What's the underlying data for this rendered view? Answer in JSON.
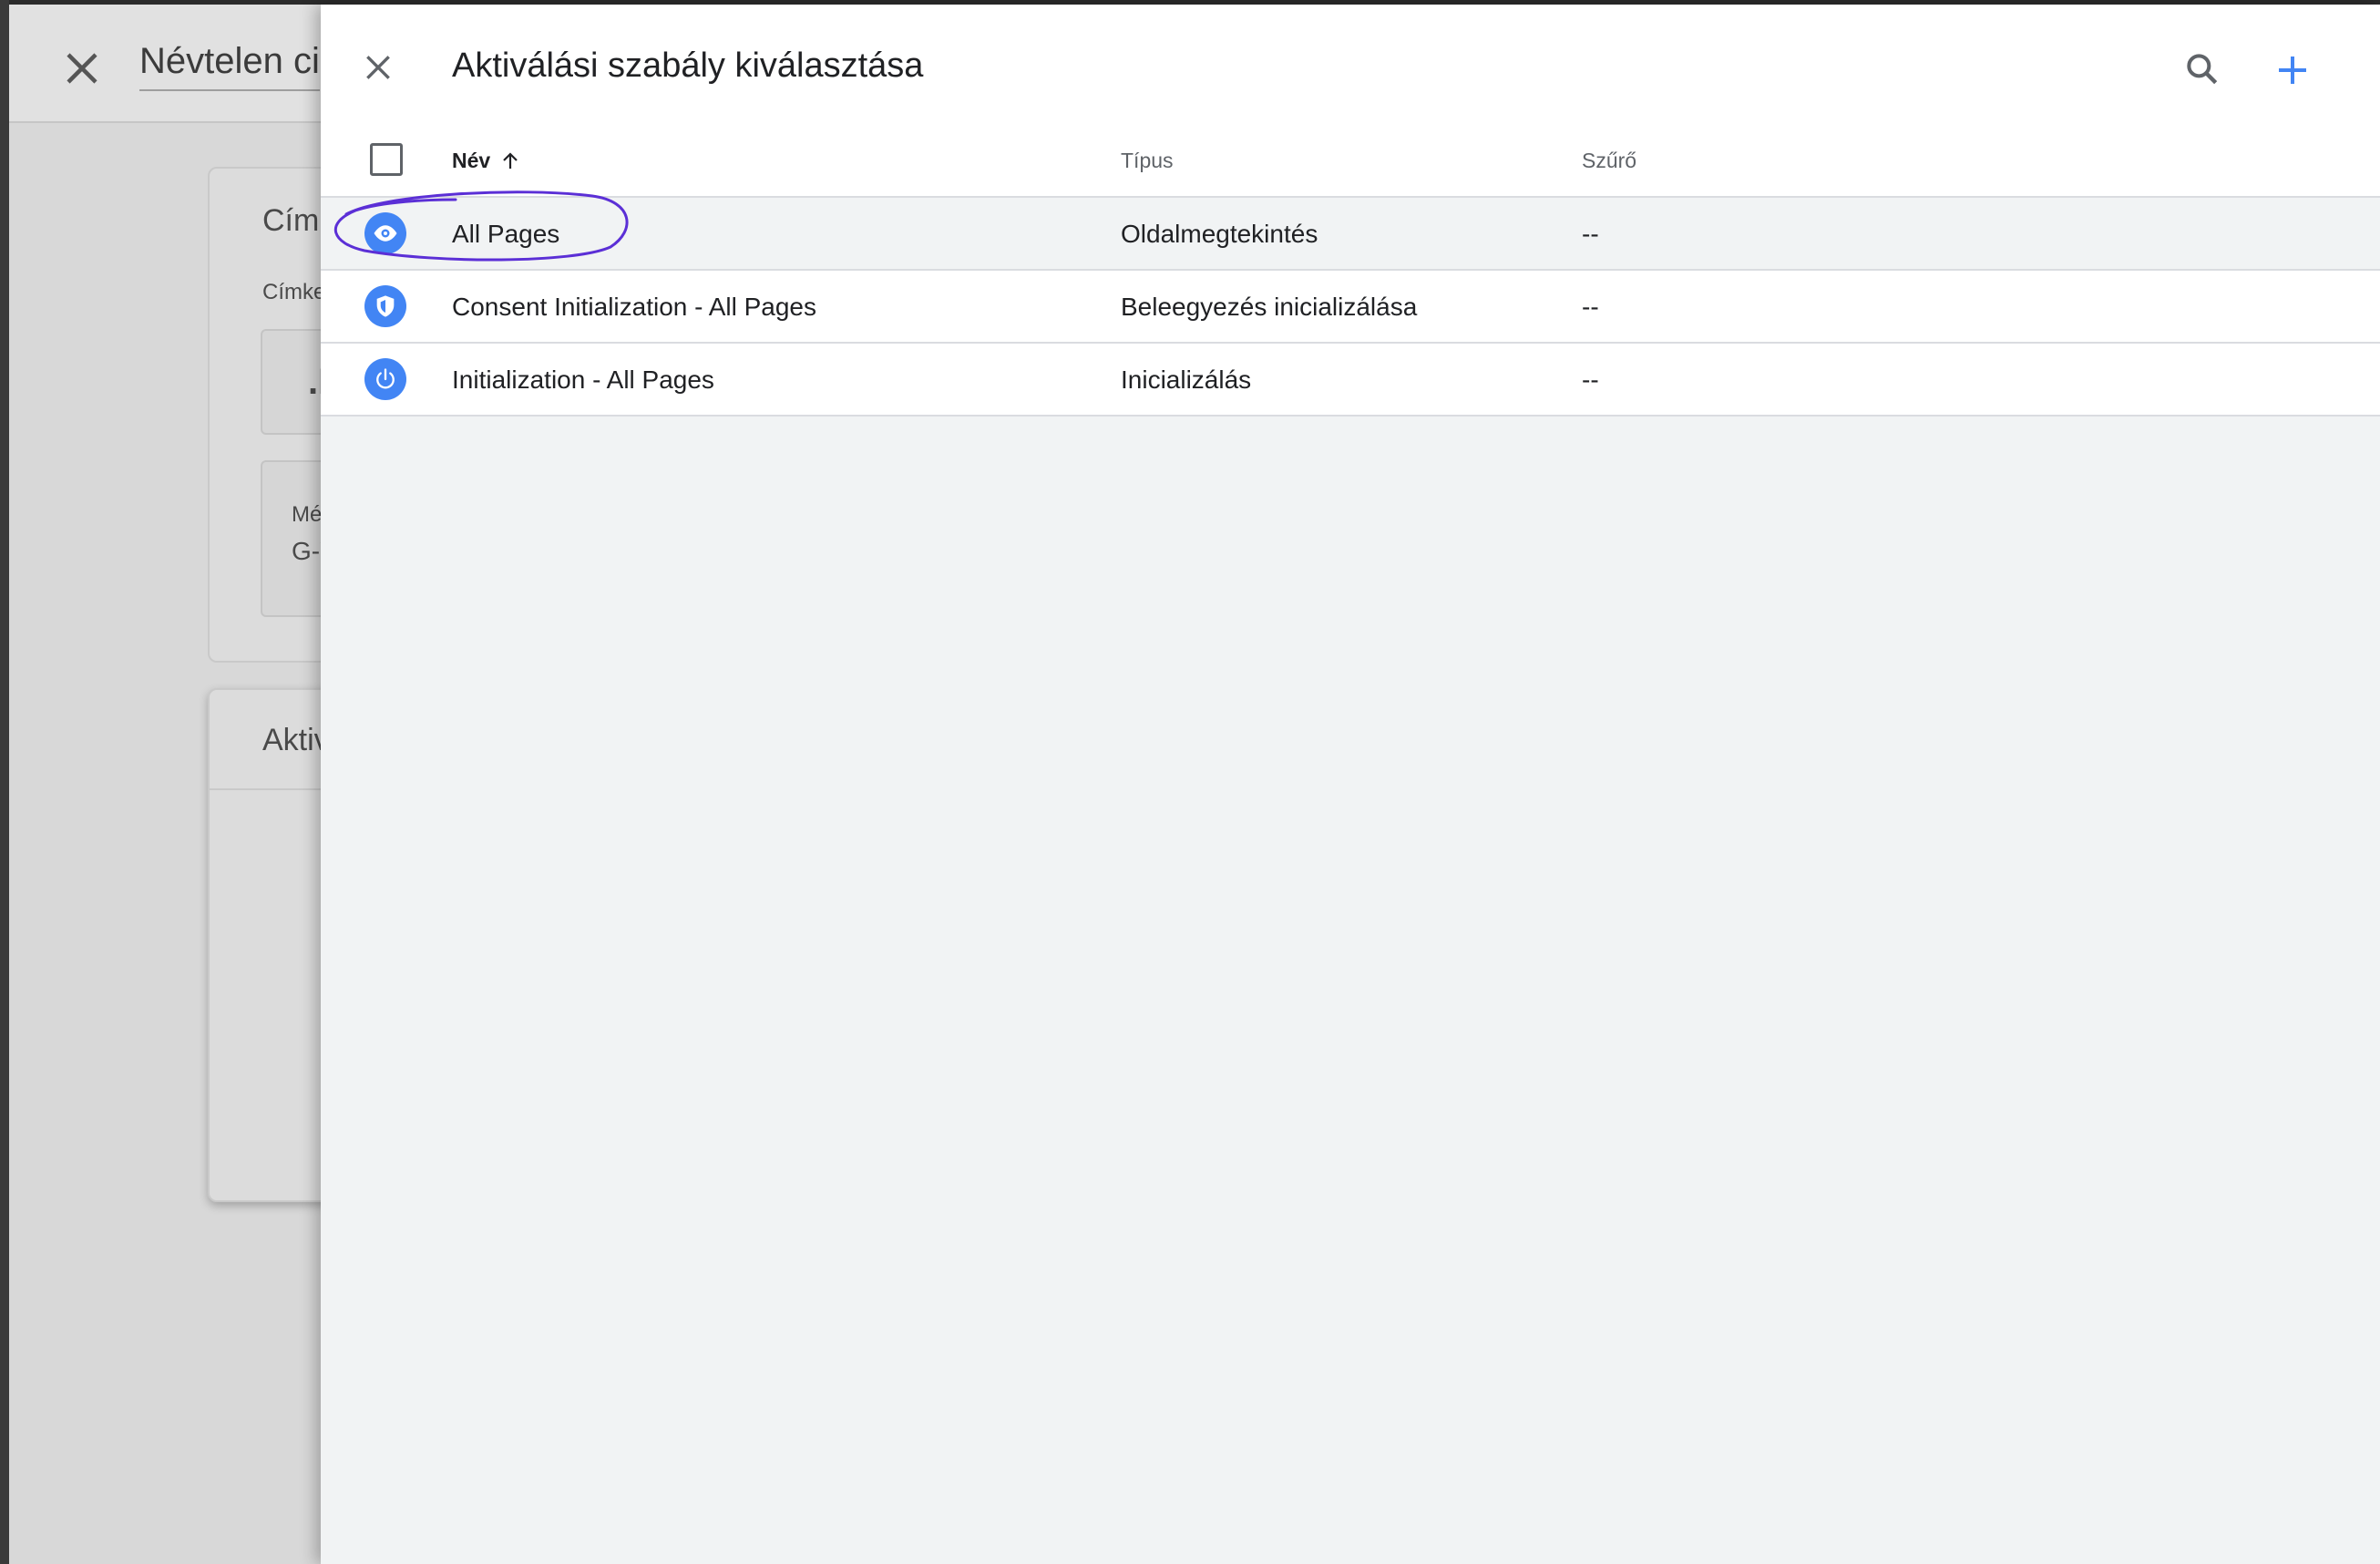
{
  "background": {
    "title": "Névtelen ci",
    "card1_title": "Címk",
    "card1_label": "Címket",
    "card1_icon_text": ".I",
    "card1_field_label": "Mér",
    "card1_field_value": "G-Y",
    "card2_title": "Aktiv"
  },
  "panel": {
    "title": "Aktiválási szabály kiválasztása",
    "columns": {
      "name": "Név",
      "type": "Típus",
      "filter": "Szűrő"
    },
    "rows": [
      {
        "name": "All Pages",
        "type": "Oldalmegtekintés",
        "filter": "--",
        "icon": "eye-icon"
      },
      {
        "name": "Consent Initialization - All Pages",
        "type": "Beleegyezés inicializálása",
        "filter": "--",
        "icon": "shield-icon"
      },
      {
        "name": "Initialization - All Pages",
        "type": "Inicializálás",
        "filter": "--",
        "icon": "power-icon"
      }
    ]
  },
  "colors": {
    "accent": "#4285f4",
    "annotation": "#5b2fd6"
  }
}
